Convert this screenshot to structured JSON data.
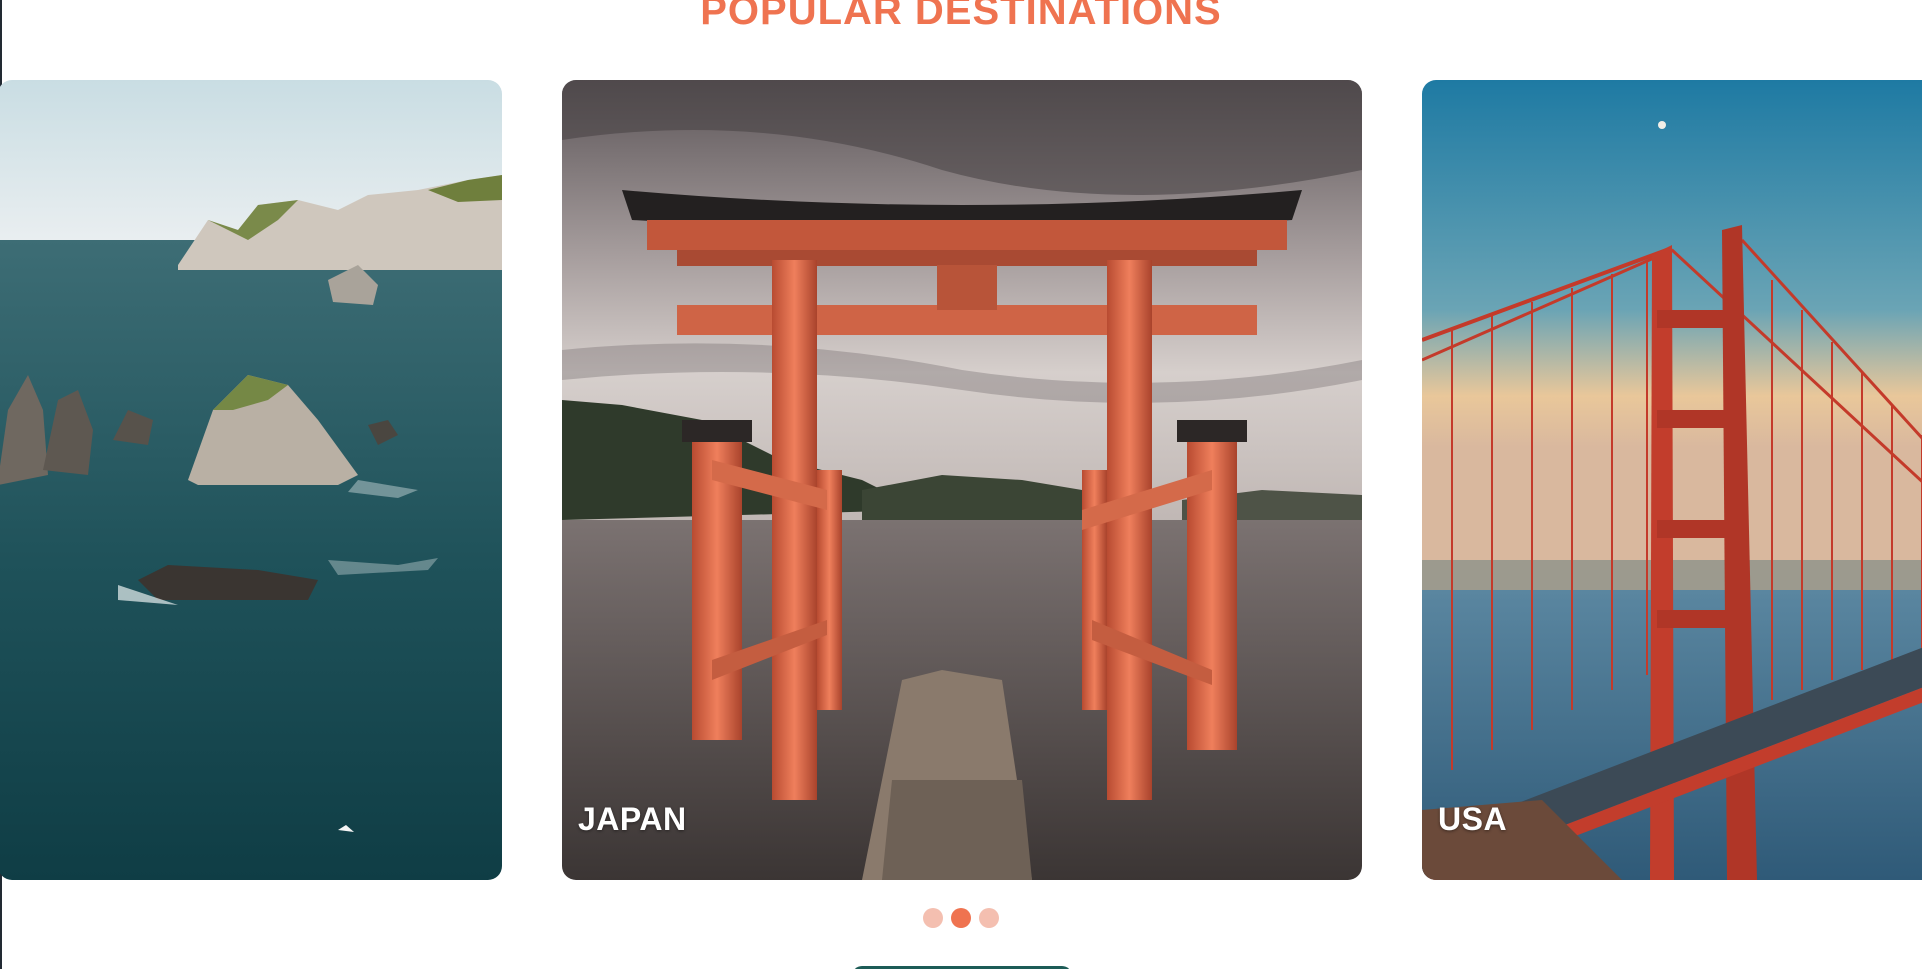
{
  "section": {
    "title": "POPULAR DESTINATIONS"
  },
  "carousel": {
    "slides": [
      {
        "caption": "",
        "scene": "coastal-sea-stacks"
      },
      {
        "caption": "JAPAN",
        "scene": "torii-gate-lake"
      },
      {
        "caption": "USA",
        "scene": "golden-gate-bridge"
      }
    ],
    "active_index": 1,
    "dot_count": 3
  },
  "colors": {
    "accent": "#ef7350",
    "dot_inactive": "#f4bfb0",
    "cta": "#1d5c57"
  }
}
